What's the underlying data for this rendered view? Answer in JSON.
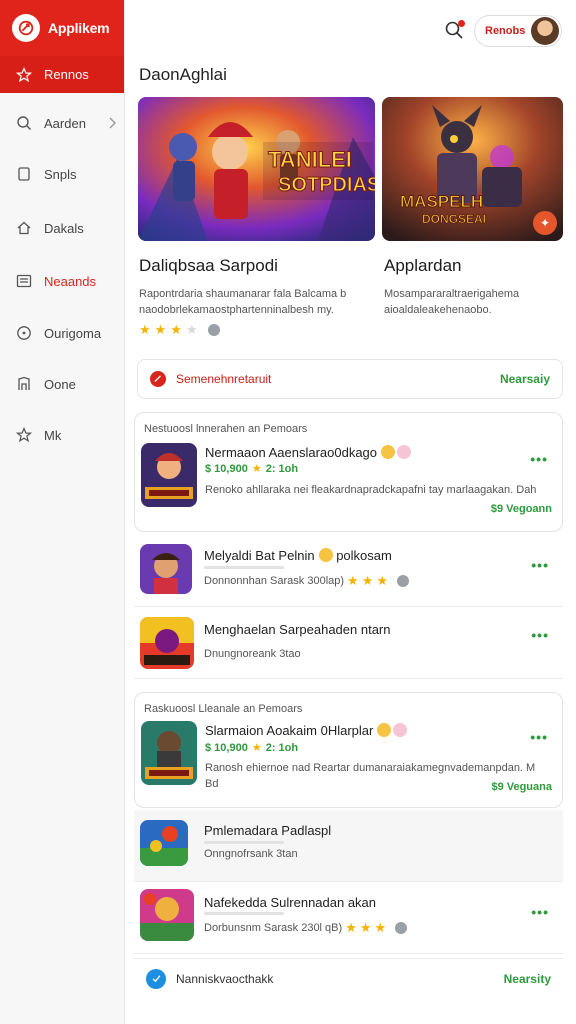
{
  "app": {
    "name": "Applikem"
  },
  "sidebar": {
    "active_item": "Rennos",
    "items": [
      {
        "label": "Aarden",
        "icon": "search-icon",
        "has_chevron": true
      },
      {
        "label": "Snpls",
        "icon": "square-icon"
      },
      {
        "label": "Dakals",
        "icon": "home-icon"
      },
      {
        "label": "Neaands",
        "icon": "list-icon",
        "selected": true
      },
      {
        "label": "Ourigoma",
        "icon": "compass-icon"
      },
      {
        "label": "Oone",
        "icon": "bookmark-icon"
      },
      {
        "label": "Mk",
        "icon": "star-icon"
      }
    ]
  },
  "header": {
    "user_name": "Renobs"
  },
  "main": {
    "title": "DaonAghlai",
    "featured": [
      {
        "art_text_1": "TANILEI",
        "art_text_2": "SOTPDIAS!",
        "title": "Daliqbsaa Sarpodi",
        "description": "Rapontrdaria shaumanarar fala Balcama b naodobrlekamaostphartenninalbesh my.",
        "rating": 3
      },
      {
        "art_text_1": "MASPELH",
        "art_text_2": "DONGSEAI",
        "title": "Applardan",
        "description": "Mosampararaltraerigahema aioaldaleakehenaobo."
      }
    ],
    "promo_bar": {
      "label": "Semenehnretaruit",
      "action": "Nearsaiy"
    },
    "cards": [
      {
        "heading": "Nestuoosl lnnerahen an Pemoars",
        "app_name": "Nermaaon Aaenslarao0dkago",
        "price": "$ 10,900",
        "rating_text": "2: 1oh",
        "description": "Renoko ahllaraka nei fleakardnapradckapafni tay marlaagakan. Dah",
        "tag": "$9 Vegoann"
      },
      {
        "heading": "Raskuoosl Lleanale an Pemoars",
        "app_name": "Slarmaion Aoakaim 0Hlarplar",
        "price": "$ 10,900",
        "rating_text": "2: 1oh",
        "description": "Ranosh ehiernoe nad Reartar dumanaraiakamegnvademanpdan. M Bd",
        "tag": "$9 Veguana"
      }
    ],
    "list_rows": [
      {
        "app_name": "Melyaldi Bat Pelnin",
        "app_name_2": "polkosam",
        "sub": "Donnonnhan Sarask 300lap)",
        "has_rating": true
      },
      {
        "app_name": "Menghaelan Sarpeahaden ntarn",
        "sub": "Dnungnoreank 3tao",
        "has_rating": false
      },
      {
        "app_name": "Pmlemadara Padlaspl",
        "sub": "Onngnofrsank 3tan",
        "has_rating": false,
        "shaded": true
      },
      {
        "app_name": "Nafekedda Sulrennadan akan",
        "sub": "Dorbunsnm Sarask 230l qB)",
        "has_rating": true
      }
    ],
    "footer_bar": {
      "label": "Nanniskvaocthakk",
      "action": "Nearsity"
    }
  }
}
